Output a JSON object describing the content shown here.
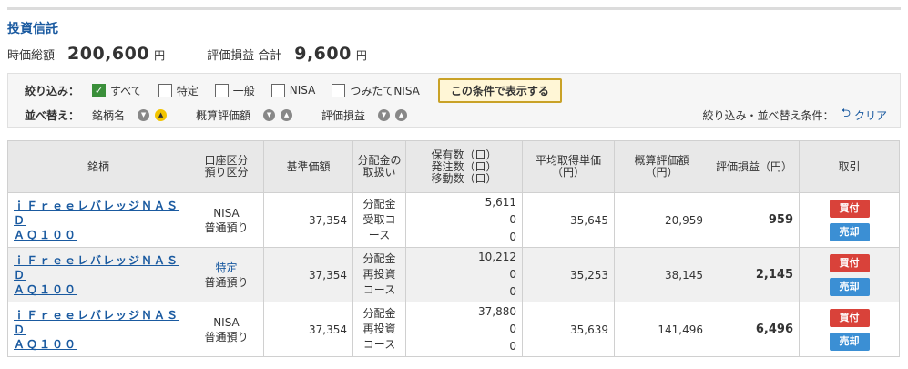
{
  "page": {
    "title": "投資信託"
  },
  "summary": {
    "market_value_label": "時価総額",
    "market_value": "200,600",
    "market_value_unit": "円",
    "pnl_label": "評価損益 合計",
    "pnl_value": "9,600",
    "pnl_unit": "円"
  },
  "filter": {
    "label": "絞り込み：",
    "options": [
      {
        "label": "すべて",
        "checked": true
      },
      {
        "label": "特定",
        "checked": false
      },
      {
        "label": "一般",
        "checked": false
      },
      {
        "label": "NISA",
        "checked": false
      },
      {
        "label": "つみたてNISA",
        "checked": false
      }
    ],
    "apply_label": "この条件で表示する"
  },
  "sort": {
    "label": "並べ替え：",
    "items": [
      {
        "label": "銘柄名",
        "active": "up"
      },
      {
        "label": "概算評価額",
        "active": "none"
      },
      {
        "label": "評価損益",
        "active": "none"
      }
    ],
    "conditions_label": "絞り込み・並べ替え条件：",
    "clear_label": "クリア"
  },
  "table": {
    "headers": {
      "name": "銘柄",
      "account": "口座区分\n預り区分",
      "base_price": "基準価額",
      "distribution": "分配金の\n取扱い",
      "quantity": "保有数（口）\n発注数（口）\n移動数（口）",
      "avg_cost": "平均取得単価\n（円）",
      "valuation": "概算評価額\n（円）",
      "pnl": "評価損益（円）",
      "trade": "取引"
    },
    "rows": [
      {
        "name_l1": "ｉＦｒｅｅレバレッジＮＡＳＤ",
        "name_l2": "ＡＱ１００",
        "account": "NISA",
        "deposit": "普通預り",
        "base_price": "37,354",
        "dist_l1": "分配金",
        "dist_l2": "受取コ",
        "dist_l3": "ース",
        "held": "5,611",
        "ordered": "0",
        "moved": "0",
        "avg_cost": "35,645",
        "valuation": "20,959",
        "pnl": "959",
        "buy": "買付",
        "sell": "売却"
      },
      {
        "name_l1": "ｉＦｒｅｅレバレッジＮＡＳＤ",
        "name_l2": "ＡＱ１００",
        "account": "特定",
        "deposit": "普通預り",
        "base_price": "37,354",
        "dist_l1": "分配金",
        "dist_l2": "再投資",
        "dist_l3": "コース",
        "held": "10,212",
        "ordered": "0",
        "moved": "0",
        "avg_cost": "35,253",
        "valuation": "38,145",
        "pnl": "2,145",
        "buy": "買付",
        "sell": "売却"
      },
      {
        "name_l1": "ｉＦｒｅｅレバレッジＮＡＳＤ",
        "name_l2": "ＡＱ１００",
        "account": "NISA",
        "deposit": "普通預り",
        "base_price": "37,354",
        "dist_l1": "分配金",
        "dist_l2": "再投資",
        "dist_l3": "コース",
        "held": "37,880",
        "ordered": "0",
        "moved": "0",
        "avg_cost": "35,639",
        "valuation": "141,496",
        "pnl": "6,496",
        "buy": "買付",
        "sell": "売却"
      }
    ]
  }
}
